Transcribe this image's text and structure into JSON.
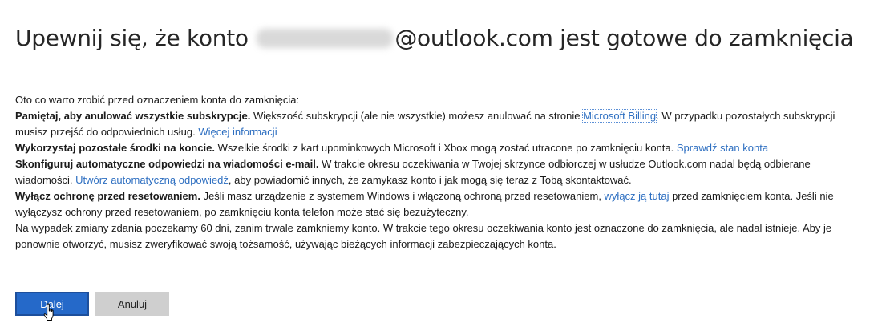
{
  "title": {
    "before": "Upewnij się, że konto",
    "after": "@outlook.com jest gotowe do zamknięcia"
  },
  "intro": "Oto co warto zrobić przed oznaczeniem konta do zamknięcia:",
  "sections": {
    "subscriptions": {
      "bold": "Pamiętaj, aby anulować wszystkie subskrypcje.",
      "text1": " Większość subskrypcji (ale nie wszystkie) możesz anulować na stronie ",
      "link1": "Microsoft Billing",
      "text2": ". W przypadku pozostałych subskrypcji musisz przejść do odpowiednich usług. ",
      "link2": "Więcej informacji"
    },
    "balance": {
      "bold": "Wykorzystaj pozostałe środki na koncie.",
      "text1": " Wszelkie środki z kart upominkowych Microsoft i Xbox mogą zostać utracone po zamknięciu konta. ",
      "link1": "Sprawdź stan konta"
    },
    "autoreply": {
      "bold": "Skonfiguruj automatyczne odpowiedzi na wiadomości e-mail.",
      "text1": " W trakcie okresu oczekiwania w Twojej skrzynce odbiorczej w usłudze Outlook.com nadal będą odbierane wiadomości. ",
      "link1": "Utwórz automatyczną odpowiedź",
      "text2": ", aby powiadomić innych, że zamykasz konto i jak mogą się teraz z Tobą skontaktować."
    },
    "reset": {
      "bold": "Wyłącz ochronę przed resetowaniem.",
      "text1": " Jeśli masz urządzenie z systemem Windows i włączoną ochroną przed resetowaniem, ",
      "link1": "wyłącz ją tutaj",
      "text2": " przed zamknięciem konta. Jeśli nie wyłączysz ochrony przed resetowaniem, po zamknięciu konta telefon może stać się bezużyteczny."
    }
  },
  "notice": "Na wypadek zmiany zdania poczekamy 60 dni, zanim trwale zamkniemy konto. W trakcie tego okresu oczekiwania konto jest oznaczone do zamknięcia, ale nadal istnieje. Aby je ponownie otworzyć, musisz zweryfikować swoją tożsamość, używając bieżących informacji zabezpieczających konta.",
  "buttons": {
    "next": "Dalej",
    "cancel": "Anuluj"
  },
  "icons": {
    "cursor": "hand-pointer-icon"
  },
  "colors": {
    "link": "#2e6fc1",
    "primary": "#2569c9",
    "secondary": "#cfcfcf"
  }
}
